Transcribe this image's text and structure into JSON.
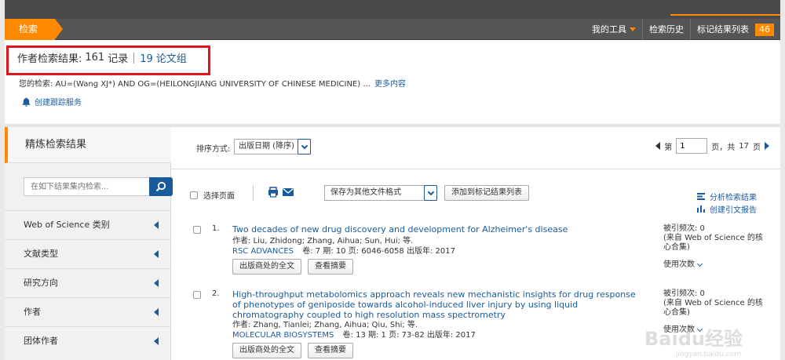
{
  "nav": {
    "tab_label": "检索",
    "my_tools": "我的工具",
    "history": "检索历史",
    "marked_list": "标记结果列表",
    "marked_count": "46"
  },
  "results": {
    "prefix": "作者检索结果:",
    "record_count": "161",
    "record_label": "记录",
    "group_count": "19",
    "group_label": "论文组"
  },
  "query": {
    "label": "您的检索: ",
    "text": "AU=(Wang XJ*) AND OG=(HEILONGJIANG UNIVERSITY OF CHINESE MEDICINE) ...",
    "more": "更多内容"
  },
  "alert": {
    "label": "创建跟踪服务"
  },
  "sidebar": {
    "title": "精炼检索结果",
    "search_placeholder": "在如下结果集内检索...",
    "facets": [
      "Web of Science 类别",
      "文献类型",
      "研究方向",
      "作者",
      "团体作者"
    ]
  },
  "sort": {
    "label": "排序方式:",
    "value": "出版日期 (降序)"
  },
  "pager": {
    "prefix": "第",
    "current": "1",
    "suffix": "页，共",
    "total": "17",
    "unit": "页"
  },
  "toolbar": {
    "select_page": "选择页面",
    "save_format": "保存为其他文件格式",
    "add_marked": "添加到标记结果列表",
    "analyze": "分析检索结果",
    "citation_report": "创建引文报告"
  },
  "records": [
    {
      "num": "1.",
      "title": "Two decades of new drug discovery and development for Alzheimer's disease",
      "authors": "作者: Liu, Zhidong; Zhang, Aihua; Sun, Hui; 等.",
      "journal": "RSC ADVANCES",
      "details": "卷: 7  期: 10  页: 6046-6058  出版年: 2017",
      "btn_fulltext": "出版商处的全文",
      "btn_abstract": "查看摘要",
      "cited": "被引频次: 0",
      "cited_src": "(来自 Web of Science 的核心合集)",
      "usage": "使用次数"
    },
    {
      "num": "2.",
      "title": "High-throughput metabolomics approach reveals new mechanistic insights for drug response of phenotypes of geniposide towards alcohol-induced liver injury by using liquid chromatography coupled to high resolution mass spectrometry",
      "authors": "作者: Zhang, Tianlei; Zhang, Aihua; Qiu, Shi; 等.",
      "journal": "MOLECULAR BIOSYSTEMS",
      "details": "卷: 13  期: 1  页: 73-82  出版年: 2017",
      "btn_fulltext": "出版商处的全文",
      "btn_abstract": "查看摘要",
      "cited": "被引频次: 0",
      "cited_src": "(来自 Web of Science 的核心合集)",
      "usage": "使用次数"
    }
  ],
  "watermark": {
    "main": "Baidu经验",
    "sub": "jingyan.baidu.com"
  },
  "colors": {
    "accent": "#ff8a00",
    "link": "#1a5b9c",
    "highlight": "#e0161f"
  }
}
